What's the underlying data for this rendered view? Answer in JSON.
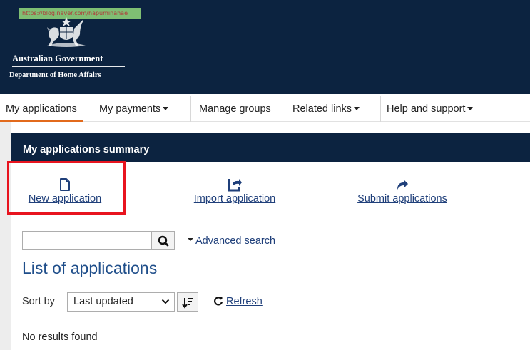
{
  "header": {
    "watermark": "https://blog.naver.com/hapuminahae",
    "government": "Australian Government",
    "department": "Department of Home Affairs",
    "background_color": "#0c2340",
    "crest_icon": "coat-of-arms-icon"
  },
  "nav": {
    "items": [
      {
        "label": "My applications",
        "active": true,
        "dropdown": false
      },
      {
        "label": "My payments",
        "active": false,
        "dropdown": true
      },
      {
        "label": "Manage groups",
        "active": false,
        "dropdown": false
      },
      {
        "label": "Related links",
        "active": false,
        "dropdown": true
      },
      {
        "label": "Help and support",
        "active": false,
        "dropdown": true
      }
    ],
    "active_color": "#e26a1c"
  },
  "summary": {
    "title": "My applications summary",
    "actions": [
      {
        "label": "New application",
        "icon": "new-document-icon"
      },
      {
        "label": "Import application",
        "icon": "import-icon"
      },
      {
        "label": "Submit applications",
        "icon": "share-arrow-icon"
      }
    ],
    "highlight_color": "#e8141f"
  },
  "search": {
    "value": "",
    "button_icon": "search-icon",
    "advanced_label": "Advanced search"
  },
  "list": {
    "title": "List of applications",
    "sort_label": "Sort by",
    "sort_selected": "Last updated",
    "sort_order_icon": "sort-descending-icon",
    "refresh_label": "Refresh",
    "refresh_icon": "refresh-icon",
    "empty_message": "No results found"
  }
}
